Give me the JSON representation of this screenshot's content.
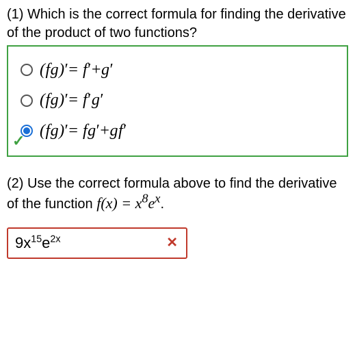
{
  "q1": {
    "prompt": "(1) Which is the correct formula for finding the derivative of the product of two functions?",
    "options": [
      {
        "formula_html": "(<i>f</i><i>g</i>)′ = <i>f</i>′+<i>g</i>′",
        "selected": false
      },
      {
        "formula_html": "(<i>f</i><i>g</i>)′ = <i>f</i>′<i>g</i>′",
        "selected": false
      },
      {
        "formula_html": "(<i>f</i><i>g</i>)′ = <i>f</i><i>g</i>′+<i>g</i><i>f</i>′",
        "selected": true
      }
    ],
    "status_icon": "check"
  },
  "q2": {
    "prompt_pre": "(2) Use the correct formula above to find the derivative of the function ",
    "prompt_math": "f(x) = x⁸eˣ",
    "prompt_post": ".",
    "answer_text": "9x¹⁵e²ˣ",
    "status_icon": "cross"
  }
}
